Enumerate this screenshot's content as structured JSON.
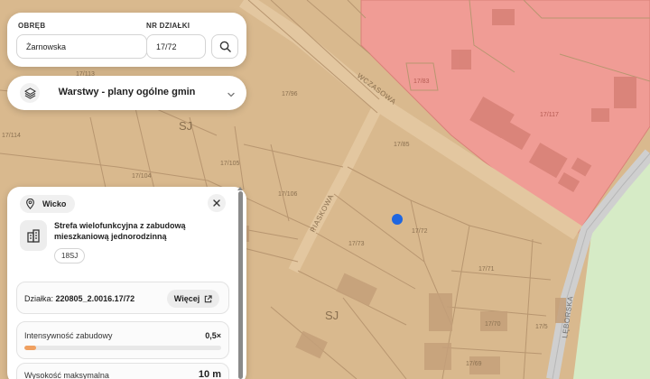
{
  "search": {
    "precinct_label": "OBRĘB",
    "precinct_value": "Żarnowska",
    "parcel_label": "NR DZIAŁKI",
    "parcel_value": "17/72"
  },
  "layers": {
    "title": "Warstwy - plany ogólne gmin"
  },
  "info": {
    "place": "Wicko",
    "zone_title": "Strefa wielofunkcyjna z zabudową mieszkaniową jednorodzinną",
    "zone_code": "18SJ",
    "parcel_label": "Działka:",
    "parcel_id": "220805_2.0016.17/72",
    "more_label": "Więcej",
    "intensity_label": "Intensywność zabudowy",
    "intensity_value": "0,5×",
    "intensity_fraction": 0.06,
    "height_label": "Wysokość maksymalna",
    "height_value": "10 m"
  },
  "map": {
    "streets": [
      "WCZASOWA",
      "PIASKOWA",
      "LĘBORSKA"
    ],
    "zone_labels": [
      "SJ",
      "SJ"
    ],
    "parcel_labels": [
      "17/96",
      "17/113",
      "17/114",
      "17/104",
      "17/105",
      "17/106",
      "17/85",
      "17/117",
      "17/83",
      "17/73",
      "17/72",
      "17/71",
      "17/70",
      "17/69",
      "17/5"
    ],
    "colors": {
      "residential_zone": "#d9b98e",
      "red_zone": "#f09c95",
      "green_zone": "#d6ebc6",
      "road": "#cfcfcf",
      "parcel_line": "#b89670",
      "building": "#c4a07a",
      "marker": "#1f66e0"
    }
  }
}
